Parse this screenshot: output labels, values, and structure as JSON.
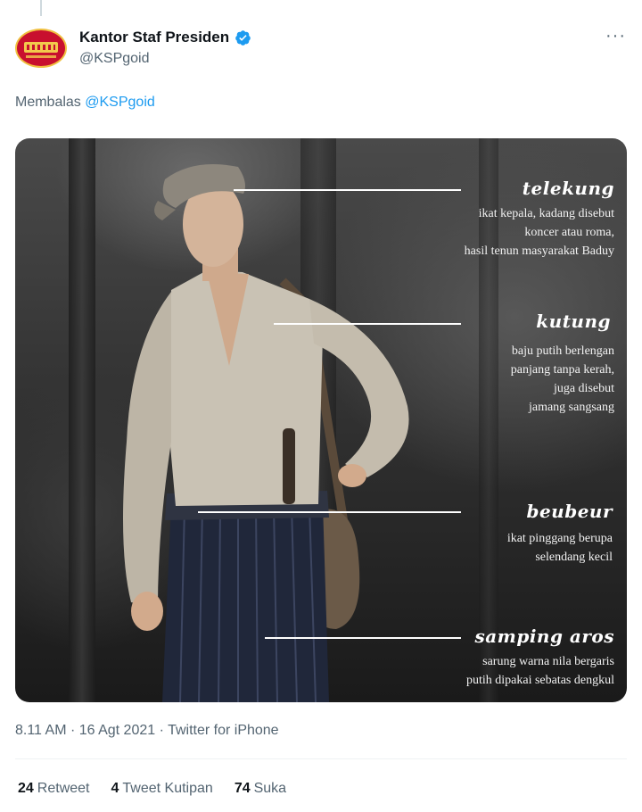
{
  "tweet": {
    "author_name": "Kantor Staf Presiden",
    "author_handle": "@KSPgoid",
    "more_icon": "more-icon",
    "reply_prefix": "Membalas",
    "reply_to": "@KSPgoid",
    "timestamp": "8.11 AM · 16 Agt 2021 · Twitter for iPhone"
  },
  "image": {
    "labels": [
      {
        "title": "telekung",
        "desc": "ikat kepala, kadang disebut\nkoncer atau roma,\nhasil tenun masyarakat Baduy"
      },
      {
        "title": "kutung",
        "desc": "baju putih berlengan\npanjang tanpa kerah,\njuga disebut\njamang sangsang"
      },
      {
        "title": "beubeur",
        "desc": "ikat pinggang berupa\nselendang kecil"
      },
      {
        "title": "samping aros",
        "desc": "sarung warna nila bergaris\nputih dipakai sebatas dengkul"
      }
    ]
  },
  "stats": {
    "retweet_count": "24",
    "retweet_label": "Retweet",
    "quote_count": "4",
    "quote_label": "Tweet Kutipan",
    "like_count": "74",
    "like_label": "Suka"
  },
  "colors": {
    "link": "#1d9bf0",
    "muted": "#536471",
    "text": "#0f1419"
  }
}
